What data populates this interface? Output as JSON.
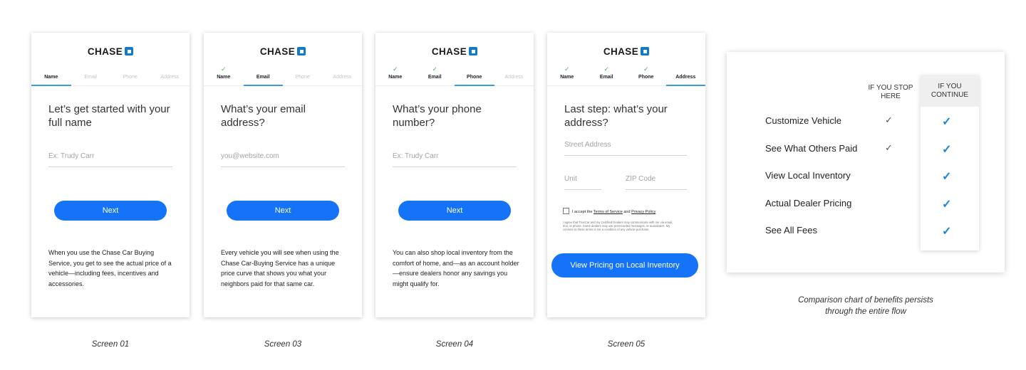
{
  "brand": "CHASE",
  "accent_color": "#1473f7",
  "check_color": "#52b548",
  "screens": [
    {
      "caption": "Screen 01",
      "steps": [
        "Name",
        "Email",
        "Phone",
        "Address"
      ],
      "question": "Let’s get started with your full name",
      "placeholder": "Ex:  Trudy Carr",
      "button": "Next",
      "body": "When you use the Chase Car Buying Service, you get to see the actual price of a vehicle—including fees, incentives and accessories."
    },
    {
      "caption": "Screen 03",
      "steps": [
        "Name",
        "Email",
        "Phone",
        "Address"
      ],
      "question": "What’s your email address?",
      "placeholder": "you@website.com",
      "button": "Next",
      "body": "Every vehicle you will see when using the Chase Car-Buying Service has a unique price curve that shows you what your neighbors paid for that same car."
    },
    {
      "caption": "Screen 04",
      "steps": [
        "Name",
        "Email",
        "Phone",
        "Address"
      ],
      "question": "What’s your phone number?",
      "placeholder": "Ex:  Trudy Carr",
      "button": "Next",
      "body": "You can also shop local inventory from the comfort of home, and—as an account holder—ensure dealers honor any savings you might qualify for."
    },
    {
      "caption": "Screen 05",
      "steps": [
        "Name",
        "Email",
        "Phone",
        "Address"
      ],
      "question": "Last step: what’s your address?",
      "street_placeholder": "Street Address",
      "unit_placeholder": "Unit",
      "zip_placeholder": "ZIP Code",
      "terms_prefix": "I accept the",
      "terms_link": "Terms of Service",
      "terms_and": "and",
      "privacy_link": "Privacy Policy",
      "fine_print": "I agree that TrueCar and my Certified Dealers may communicate with me via email, text, or phone. Some dealers may use prerecorded messages, or autodialers. My consent to these terms is not a condition of any vehicle purchase.",
      "button": "View Pricing on Local Inventory"
    }
  ],
  "comparison": {
    "stop_header": "IF YOU STOP HERE",
    "continue_header": "IF YOU CONTINUE",
    "rows": [
      {
        "label": "Customize Vehicle",
        "stop": true,
        "continue": true
      },
      {
        "label": "See What Others Paid",
        "stop": true,
        "continue": true
      },
      {
        "label": "View Local Inventory",
        "stop": false,
        "continue": true
      },
      {
        "label": "Actual Dealer Pricing",
        "stop": false,
        "continue": true
      },
      {
        "label": "See All Fees",
        "stop": false,
        "continue": true
      }
    ],
    "check_glyph": "✓",
    "caption": "Comparison chart of benefits persists through the entire flow"
  }
}
